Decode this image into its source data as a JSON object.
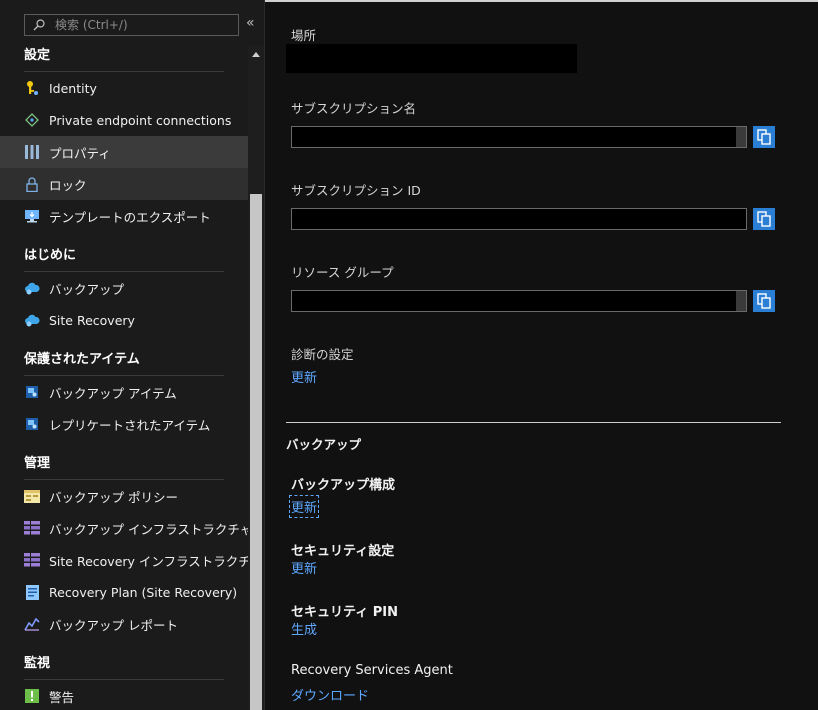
{
  "search": {
    "placeholder": "検索 (Ctrl+/)"
  },
  "sidebar": {
    "groups": [
      {
        "title": "設定",
        "items": [
          {
            "label": "Identity",
            "icon": "key-icon"
          },
          {
            "label": "Private endpoint connections",
            "icon": "endpoint-icon"
          },
          {
            "label": "プロパティ",
            "icon": "properties-icon"
          },
          {
            "label": "ロック",
            "icon": "lock-icon"
          },
          {
            "label": "テンプレートのエクスポート",
            "icon": "export-template-icon"
          }
        ]
      },
      {
        "title": "はじめに",
        "items": [
          {
            "label": "バックアップ",
            "icon": "cloud-backup-icon"
          },
          {
            "label": "Site Recovery",
            "icon": "cloud-recovery-icon"
          }
        ]
      },
      {
        "title": "保護されたアイテム",
        "items": [
          {
            "label": "バックアップ アイテム",
            "icon": "backup-items-icon"
          },
          {
            "label": "レプリケートされたアイテム",
            "icon": "replicated-items-icon"
          }
        ]
      },
      {
        "title": "管理",
        "items": [
          {
            "label": "バックアップ ポリシー",
            "icon": "policy-icon"
          },
          {
            "label": "バックアップ インフラストラクチャ",
            "icon": "infrastructure-icon"
          },
          {
            "label": "Site Recovery インフラストラクチャ",
            "icon": "infrastructure-icon"
          },
          {
            "label": "Recovery Plan (Site Recovery)",
            "icon": "recovery-plan-icon"
          },
          {
            "label": "バックアップ レポート",
            "icon": "report-icon"
          }
        ]
      },
      {
        "title": "監視",
        "items": [
          {
            "label": "警告",
            "icon": "alert-icon"
          }
        ]
      }
    ]
  },
  "main": {
    "location_label": "場所",
    "subscription_name_label": "サブスクリプション名",
    "subscription_id_label": "サブスクリプション ID",
    "resource_group_label": "リソース グループ",
    "diagnostics_label": "診断の設定",
    "diagnostics_link": "更新",
    "backup_section": "バックアップ",
    "backup_config_title": "バックアップ構成",
    "backup_config_link": "更新",
    "security_settings_title": "セキュリティ設定",
    "security_settings_link": "更新",
    "security_pin_title": "セキュリティ PIN",
    "security_pin_link": "生成",
    "agent_title": "Recovery Services Agent",
    "agent_link": "ダウンロード"
  },
  "colors": {
    "accent": "#2a7fd4",
    "link": "#5ea8ff",
    "background": "#111111"
  }
}
